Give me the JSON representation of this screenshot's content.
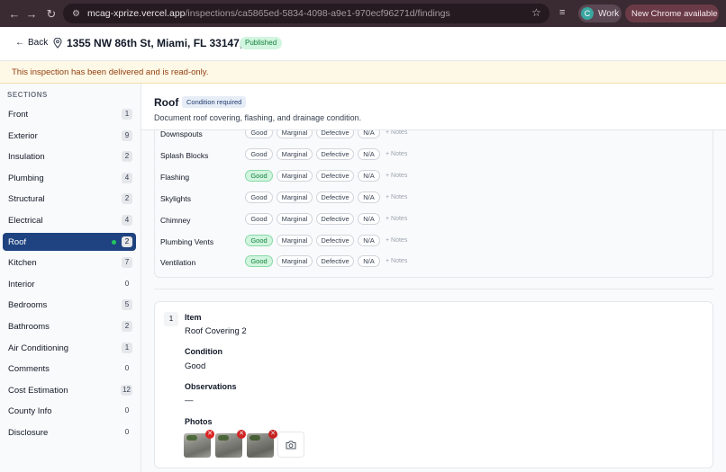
{
  "browser": {
    "url_host": "mcag-xprize.vercel.app",
    "url_path": "/inspections/ca5865ed-5834-4098-a9e1-970ecf96271d/findings",
    "profile_initial": "C",
    "profile_label": "Work",
    "update_label": "New Chrome available"
  },
  "header": {
    "back_label": "Back",
    "address": "1355 NW 86th St, Miami, FL 33147, USA",
    "status_badge": "Published"
  },
  "banner": {
    "text": "This inspection has been delivered and is read-only."
  },
  "sidebar": {
    "title": "SECTIONS",
    "items": [
      {
        "label": "Front",
        "count": "1"
      },
      {
        "label": "Exterior",
        "count": "9"
      },
      {
        "label": "Insulation",
        "count": "2"
      },
      {
        "label": "Plumbing",
        "count": "4"
      },
      {
        "label": "Structural",
        "count": "2"
      },
      {
        "label": "Electrical",
        "count": "4"
      },
      {
        "label": "Roof",
        "count": "2"
      },
      {
        "label": "Kitchen",
        "count": "7"
      },
      {
        "label": "Interior",
        "count": "0"
      },
      {
        "label": "Bedrooms",
        "count": "5"
      },
      {
        "label": "Bathrooms",
        "count": "2"
      },
      {
        "label": "Air Conditioning",
        "count": "1"
      },
      {
        "label": "Comments",
        "count": "0"
      },
      {
        "label": "Cost Estimation",
        "count": "12"
      },
      {
        "label": "County Info",
        "count": "0"
      },
      {
        "label": "Disclosure",
        "count": "0"
      }
    ],
    "active": "Roof"
  },
  "section": {
    "title": "Roof",
    "badge": "Condition required",
    "description": "Document roof covering, flashing, and drainage condition."
  },
  "condition_options": {
    "good": "Good",
    "marginal": "Marginal",
    "defective": "Defective",
    "na": "N/A",
    "notes": "+ Notes"
  },
  "checklist": [
    {
      "label": "Downspouts",
      "selected": ""
    },
    {
      "label": "Splash Blocks",
      "selected": ""
    },
    {
      "label": "Flashing",
      "selected": "Good"
    },
    {
      "label": "Skylights",
      "selected": ""
    },
    {
      "label": "Chimney",
      "selected": ""
    },
    {
      "label": "Plumbing Vents",
      "selected": "Good"
    },
    {
      "label": "Ventilation",
      "selected": "Good"
    }
  ],
  "finding": {
    "number": "1",
    "item_label": "Item",
    "item_value": "Roof Covering 2",
    "condition_label": "Condition",
    "condition_value": "Good",
    "observations_label": "Observations",
    "observations_value": "—",
    "photos_label": "Photos",
    "photo_count": 3
  },
  "colors": {
    "active_nav": "#1f4380",
    "good_bg": "#d1f5df",
    "good_text": "#15803d",
    "banner_bg": "#fef8e7",
    "banner_text": "#92400e",
    "remove_photo": "#dc2626"
  }
}
